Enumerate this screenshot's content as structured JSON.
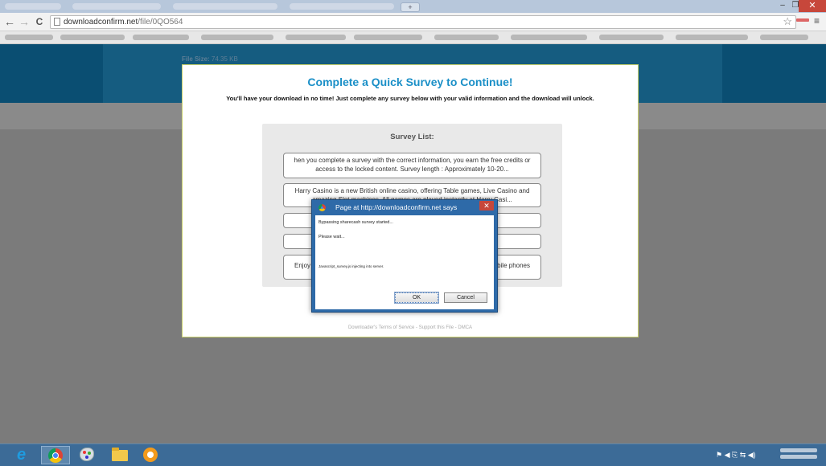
{
  "browser": {
    "url_domain": "downloadconfirm.net",
    "url_path": "/file/0QO564",
    "back_icon": "←",
    "forward_icon": "→",
    "reload_icon": "C",
    "star_icon": "☆",
    "menu_icon": "≡",
    "new_tab_icon": "+",
    "minimize_icon": "–",
    "restore_icon": "❐",
    "close_icon": "✕"
  },
  "page": {
    "file_size_label": "File Size:",
    "file_size_value": "74.35 KB",
    "title": "Complete a Quick Survey to Continue!",
    "subtitle": "You'll have your download in no time! Just complete any survey below with your valid information and the download will unlock.",
    "survey_list_title": "Survey List:",
    "offers": [
      "hen you complete a survey with the correct information, you earn the free credits or access to the locked content. Survey length : Approximately 10-20...",
      "Harry Casino is a new British online casino, offering Table games, Live Casino and amazing Slot machines. All games are played instantly at Harry Casi...",
      "",
      "",
      "Enjoy",
      "bile phones"
    ],
    "footer": {
      "terms": "Downloader's Terms of Service",
      "sep1": " - ",
      "support": "Support this File",
      "sep2": " - ",
      "dmca": "DMCA"
    }
  },
  "dialog": {
    "title": "Page at http://downloadconfirm.net says",
    "close_icon": "✕",
    "line1": "Bypassing sharecash survey started...",
    "line2": "Please wait...",
    "line3": "Javascript_survey.js injecting into server.",
    "ok_label": "OK",
    "cancel_label": "Cancel"
  },
  "taskbar": {
    "tray_icons": "⚑ ◀ ⎘ ⇆ ◀)"
  }
}
